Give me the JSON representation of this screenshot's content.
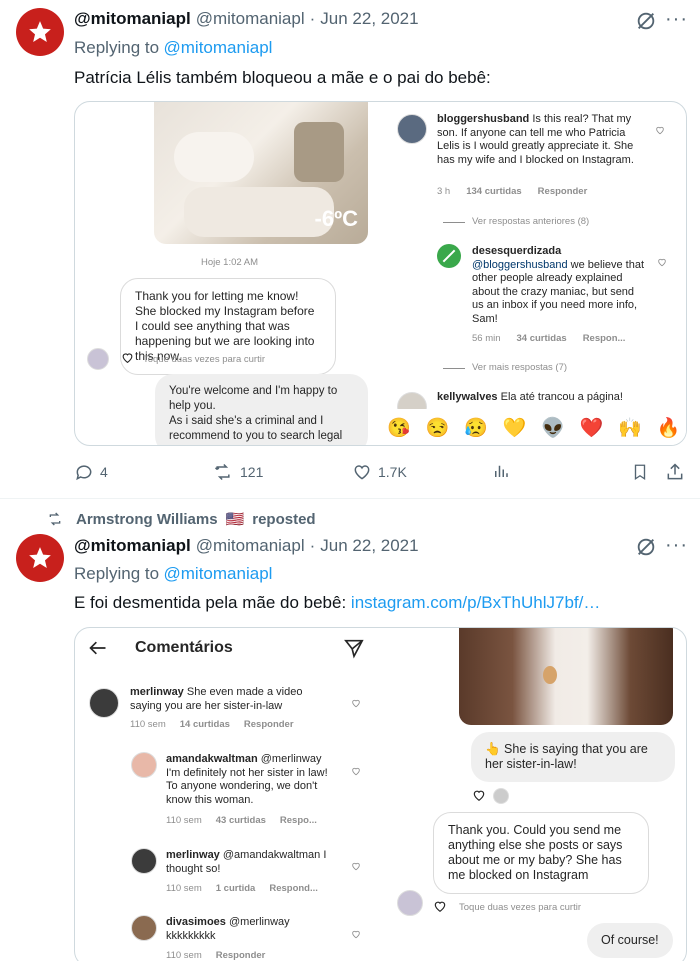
{
  "tweet1": {
    "display_name": "@mitomaniapl",
    "handle": "@mitomaniapl",
    "sep": "·",
    "date": "Jun 22, 2021",
    "replying_prefix": "Replying to",
    "replying_to": "@mitomaniapl",
    "text": "Patrícia Lélis também bloqueou a mãe e o pai do bebê:",
    "actions": {
      "replies": "4",
      "retweets": "121",
      "likes": "1.7K"
    },
    "image": {
      "photo_temp": "-6ºC",
      "timestamp": "Hoje 1:02 AM",
      "bubble1": "Thank you for letting me know! She blocked my Instagram before I could see anything that was happening but we are looking into this now.",
      "double_tap": "Toque duas vezes para curtir",
      "bubble2": "You're welcome and I'm happy to help you.\nAs i said she's a criminal and I recommend to you to search legal and police help to avoid problems",
      "comments": [
        {
          "user": "bloggershusband",
          "text": "Is this real? That my son. If anyone can tell me who Patricia Lelis is I would greatly appreciate it. She has my wife and I blocked on Instagram.",
          "time": "3 h",
          "likes": "134 curtidas",
          "reply": "Responder"
        },
        {
          "user": "desesquerdizada",
          "mention": "@bloggershusband",
          "text": "we believe that other people already explained about the crazy maniac, but send us an inbox if you need more info, Sam!",
          "time": "56 min",
          "likes": "34 curtidas",
          "reply": "Respon..."
        },
        {
          "user": "kellywalves",
          "text": "Ela até trancou a página!"
        }
      ],
      "view_previous": "Ver respostas anteriores (8)",
      "view_more": "Ver mais respostas (7)",
      "emojis": [
        "😘",
        "😒",
        "😥",
        "💛",
        "👽",
        "❤️",
        "🙌",
        "🔥"
      ]
    }
  },
  "repost": {
    "name": "Armstrong Williams",
    "flag": "🇺🇸",
    "label": "reposted"
  },
  "tweet2": {
    "display_name": "@mitomaniapl",
    "handle": "@mitomaniapl",
    "sep": "·",
    "date": "Jun 22, 2021",
    "replying_prefix": "Replying to",
    "replying_to": "@mitomaniapl",
    "text": "E foi desmentida pela mãe do bebê:",
    "link": "instagram.com/p/BxThUhlJ7bf/…",
    "image": {
      "header": "Comentários",
      "comments": [
        {
          "user": "merlinway",
          "text": "She even made a video saying you are her sister-in-law",
          "time": "110 sem",
          "likes": "14 curtidas",
          "reply": "Responder"
        },
        {
          "user": "amandakwaltman",
          "mention": "@merlinway",
          "text": "I'm definitely not her sister in law! To anyone wondering, we don't know this woman.",
          "time": "110 sem",
          "likes": "43 curtidas",
          "reply": "Respo..."
        },
        {
          "user": "merlinway",
          "mention": "@amandakwaltman",
          "text": "I thought so!",
          "time": "110 sem",
          "likes": "1 curtida",
          "reply": "Respond..."
        },
        {
          "user": "divasimoes",
          "mention": "@merlinway",
          "text": "kkkkkkkkk",
          "time": "110 sem",
          "reply": "Responder"
        }
      ],
      "dm_bubble_grey": "👆 She is saying that you are her sister-in-law!",
      "dm_bubble": "Thank you. Could you send me anything else she posts or says about me or my baby? She has me blocked on Instagram",
      "double_tap": "Toque duas vezes para curtir",
      "dm_last": "Of course!"
    }
  },
  "colors": {
    "link": "#1d9bf0",
    "muted": "#536471",
    "avatar": "#c8201c",
    "heart": "#e0245e"
  }
}
